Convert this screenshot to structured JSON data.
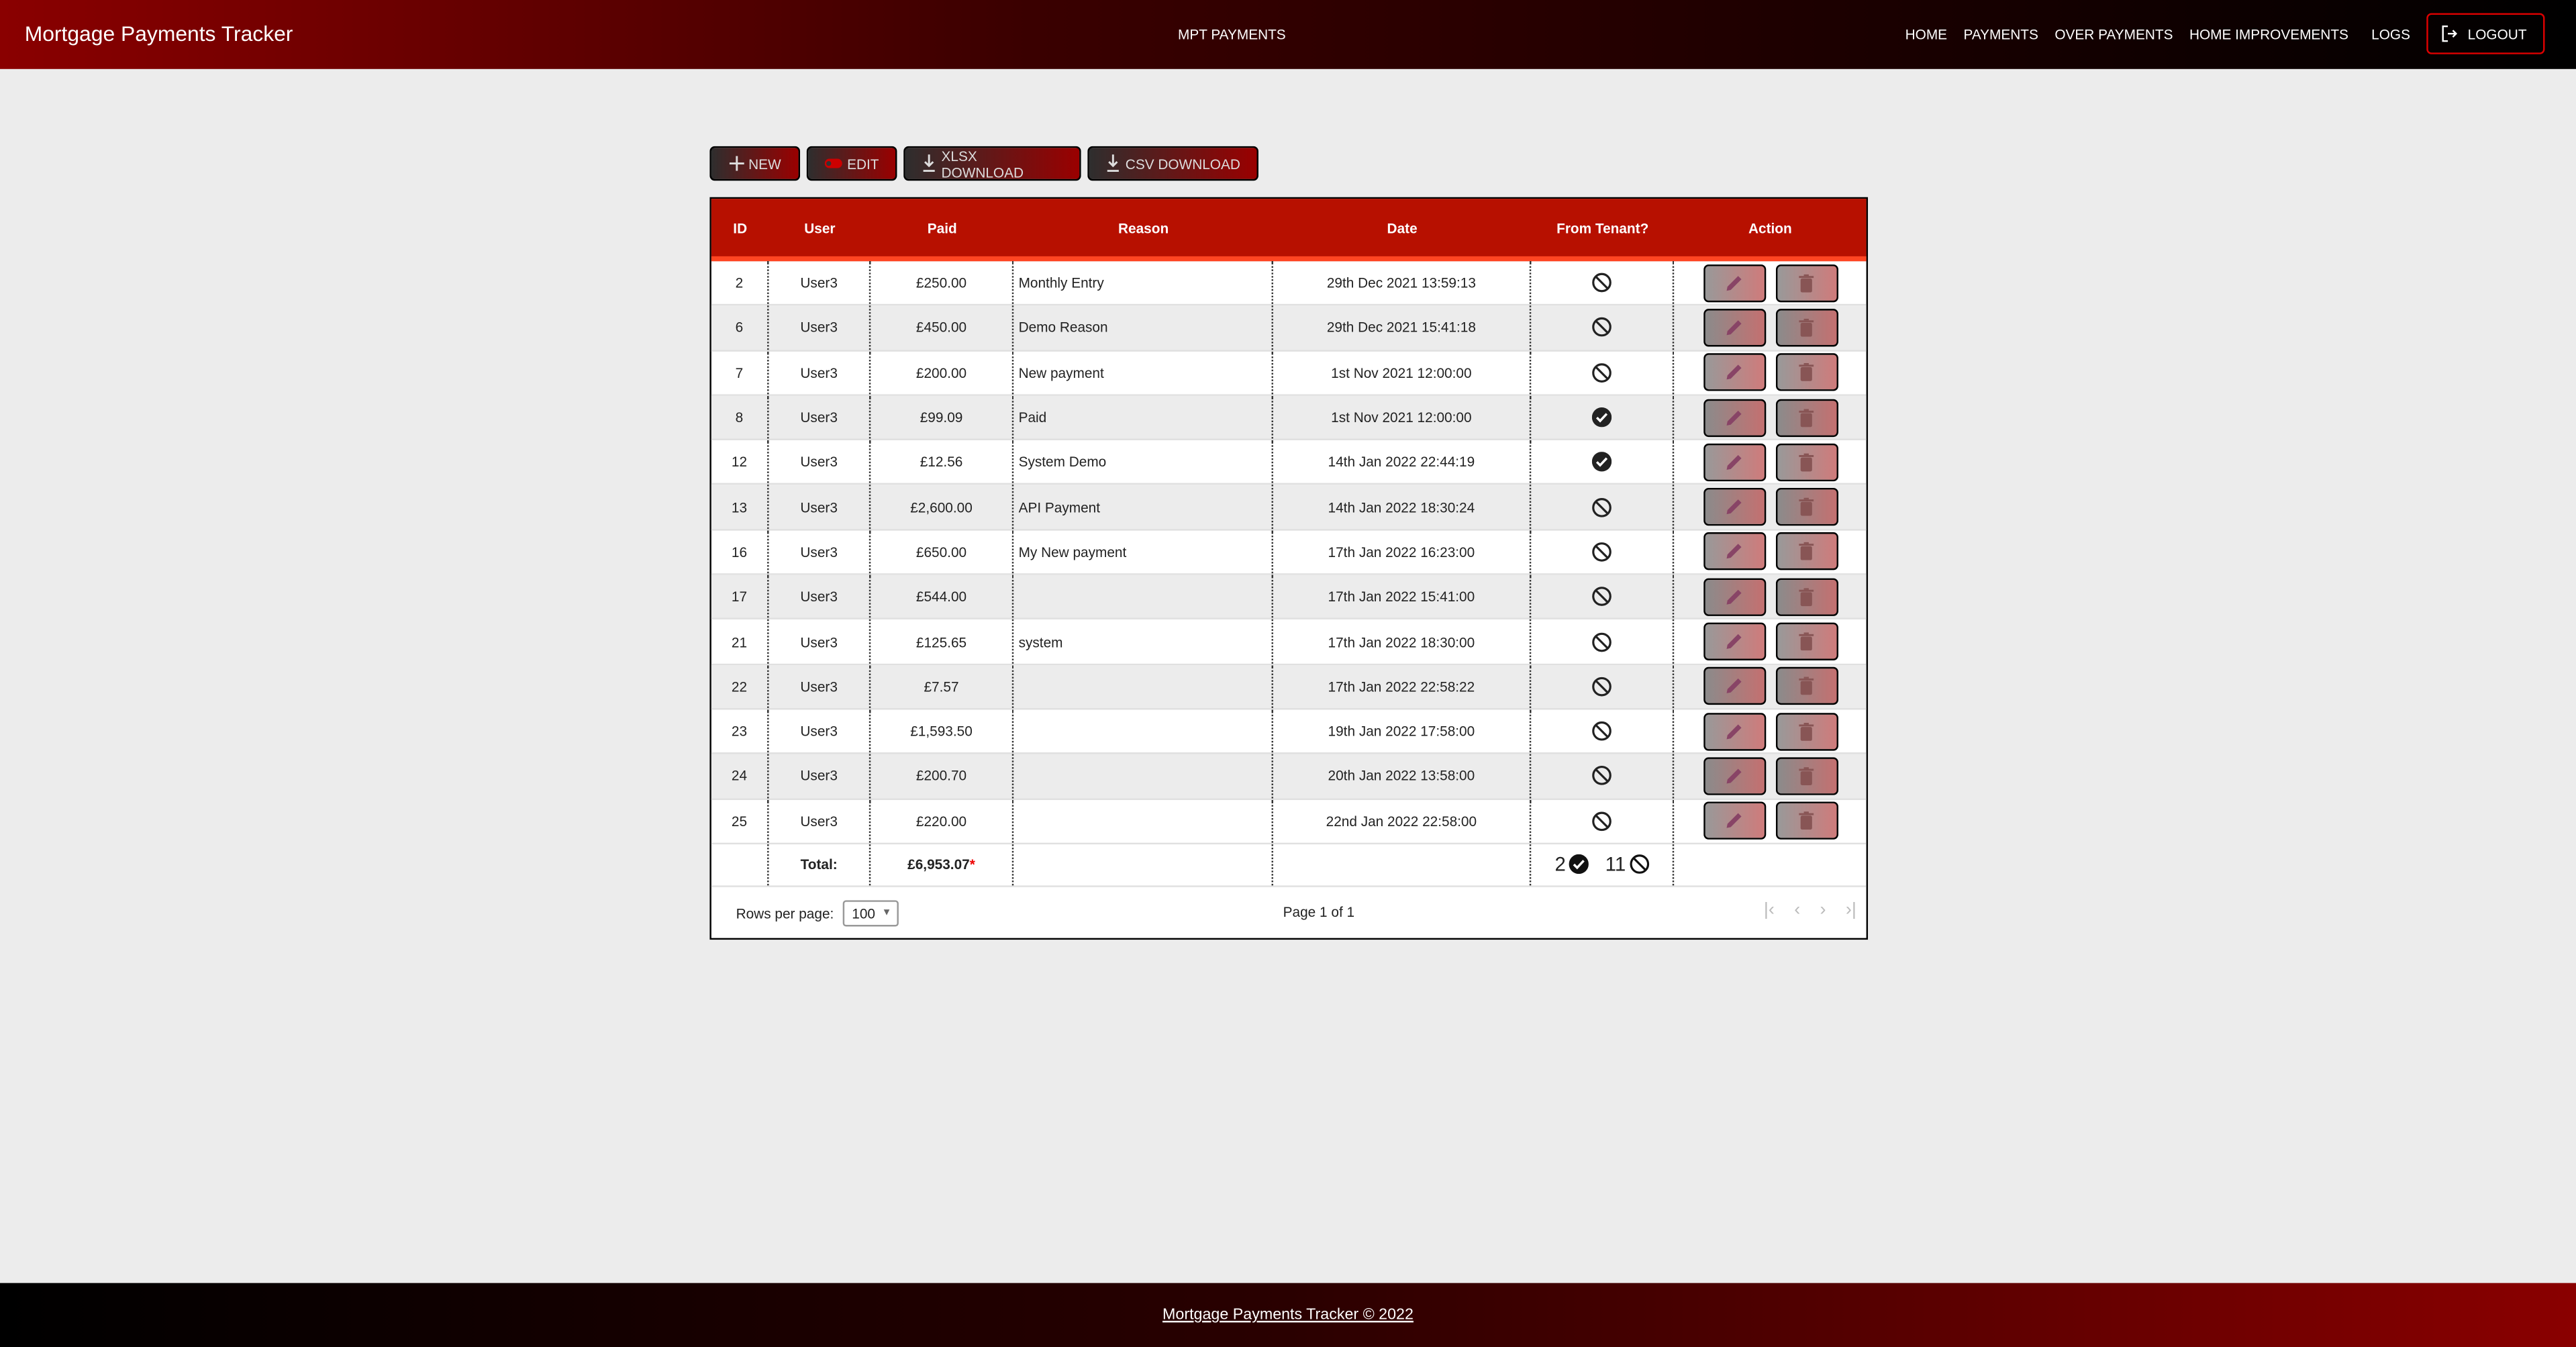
{
  "header": {
    "brand": "Mortgage Payments Tracker",
    "center_title": "MPT PAYMENTS",
    "nav": [
      "HOME",
      "PAYMENTS",
      "OVER PAYMENTS",
      "HOME IMPROVEMENTS",
      "LOGS"
    ],
    "logout": "LOGOUT"
  },
  "toolbar": {
    "new": "NEW",
    "edit": "EDIT",
    "xlsx": "XLSX DOWNLOAD",
    "csv": "CSV DOWNLOAD"
  },
  "table": {
    "columns": [
      "ID",
      "User",
      "Paid",
      "Reason",
      "Date",
      "From Tenant?",
      "Action"
    ],
    "rows": [
      {
        "id": "2",
        "user": "User3",
        "paid": "£250.00",
        "reason": "Monthly Entry",
        "date": "29th Dec 2021 13:59:13",
        "tenant": false
      },
      {
        "id": "6",
        "user": "User3",
        "paid": "£450.00",
        "reason": "Demo Reason",
        "date": "29th Dec 2021 15:41:18",
        "tenant": false
      },
      {
        "id": "7",
        "user": "User3",
        "paid": "£200.00",
        "reason": "New payment",
        "date": "1st Nov 2021 12:00:00",
        "tenant": false
      },
      {
        "id": "8",
        "user": "User3",
        "paid": "£99.09",
        "reason": "Paid",
        "date": "1st Nov 2021 12:00:00",
        "tenant": true
      },
      {
        "id": "12",
        "user": "User3",
        "paid": "£12.56",
        "reason": "System Demo",
        "date": "14th Jan 2022 22:44:19",
        "tenant": true
      },
      {
        "id": "13",
        "user": "User3",
        "paid": "£2,600.00",
        "reason": "API Payment",
        "date": "14th Jan 2022 18:30:24",
        "tenant": false
      },
      {
        "id": "16",
        "user": "User3",
        "paid": "£650.00",
        "reason": "My New payment",
        "date": "17th Jan 2022 16:23:00",
        "tenant": false
      },
      {
        "id": "17",
        "user": "User3",
        "paid": "£544.00",
        "reason": "",
        "date": "17th Jan 2022 15:41:00",
        "tenant": false
      },
      {
        "id": "21",
        "user": "User3",
        "paid": "£125.65",
        "reason": "system",
        "date": "17th Jan 2022 18:30:00",
        "tenant": false
      },
      {
        "id": "22",
        "user": "User3",
        "paid": "£7.57",
        "reason": "",
        "date": "17th Jan 2022 22:58:22",
        "tenant": false
      },
      {
        "id": "23",
        "user": "User3",
        "paid": "£1,593.50",
        "reason": "",
        "date": "19th Jan 2022 17:58:00",
        "tenant": false
      },
      {
        "id": "24",
        "user": "User3",
        "paid": "£200.70",
        "reason": "",
        "date": "20th Jan 2022 13:58:00",
        "tenant": false
      },
      {
        "id": "25",
        "user": "User3",
        "paid": "£220.00",
        "reason": "",
        "date": "22nd Jan 2022 22:58:00",
        "tenant": false
      }
    ],
    "total": {
      "label": "Total:",
      "paid": "£6,953.07",
      "asterisk": "*",
      "tenant_yes": "2",
      "tenant_no": "11"
    }
  },
  "pagination": {
    "rows_per_page_label": "Rows per page:",
    "rows_per_page": "100",
    "page_info": "Page 1 of 1"
  },
  "footer": {
    "text": "Mortgage Payments Tracker © 2022"
  },
  "colors": {
    "header_red": "#b71000",
    "accent": "#ff4522"
  }
}
